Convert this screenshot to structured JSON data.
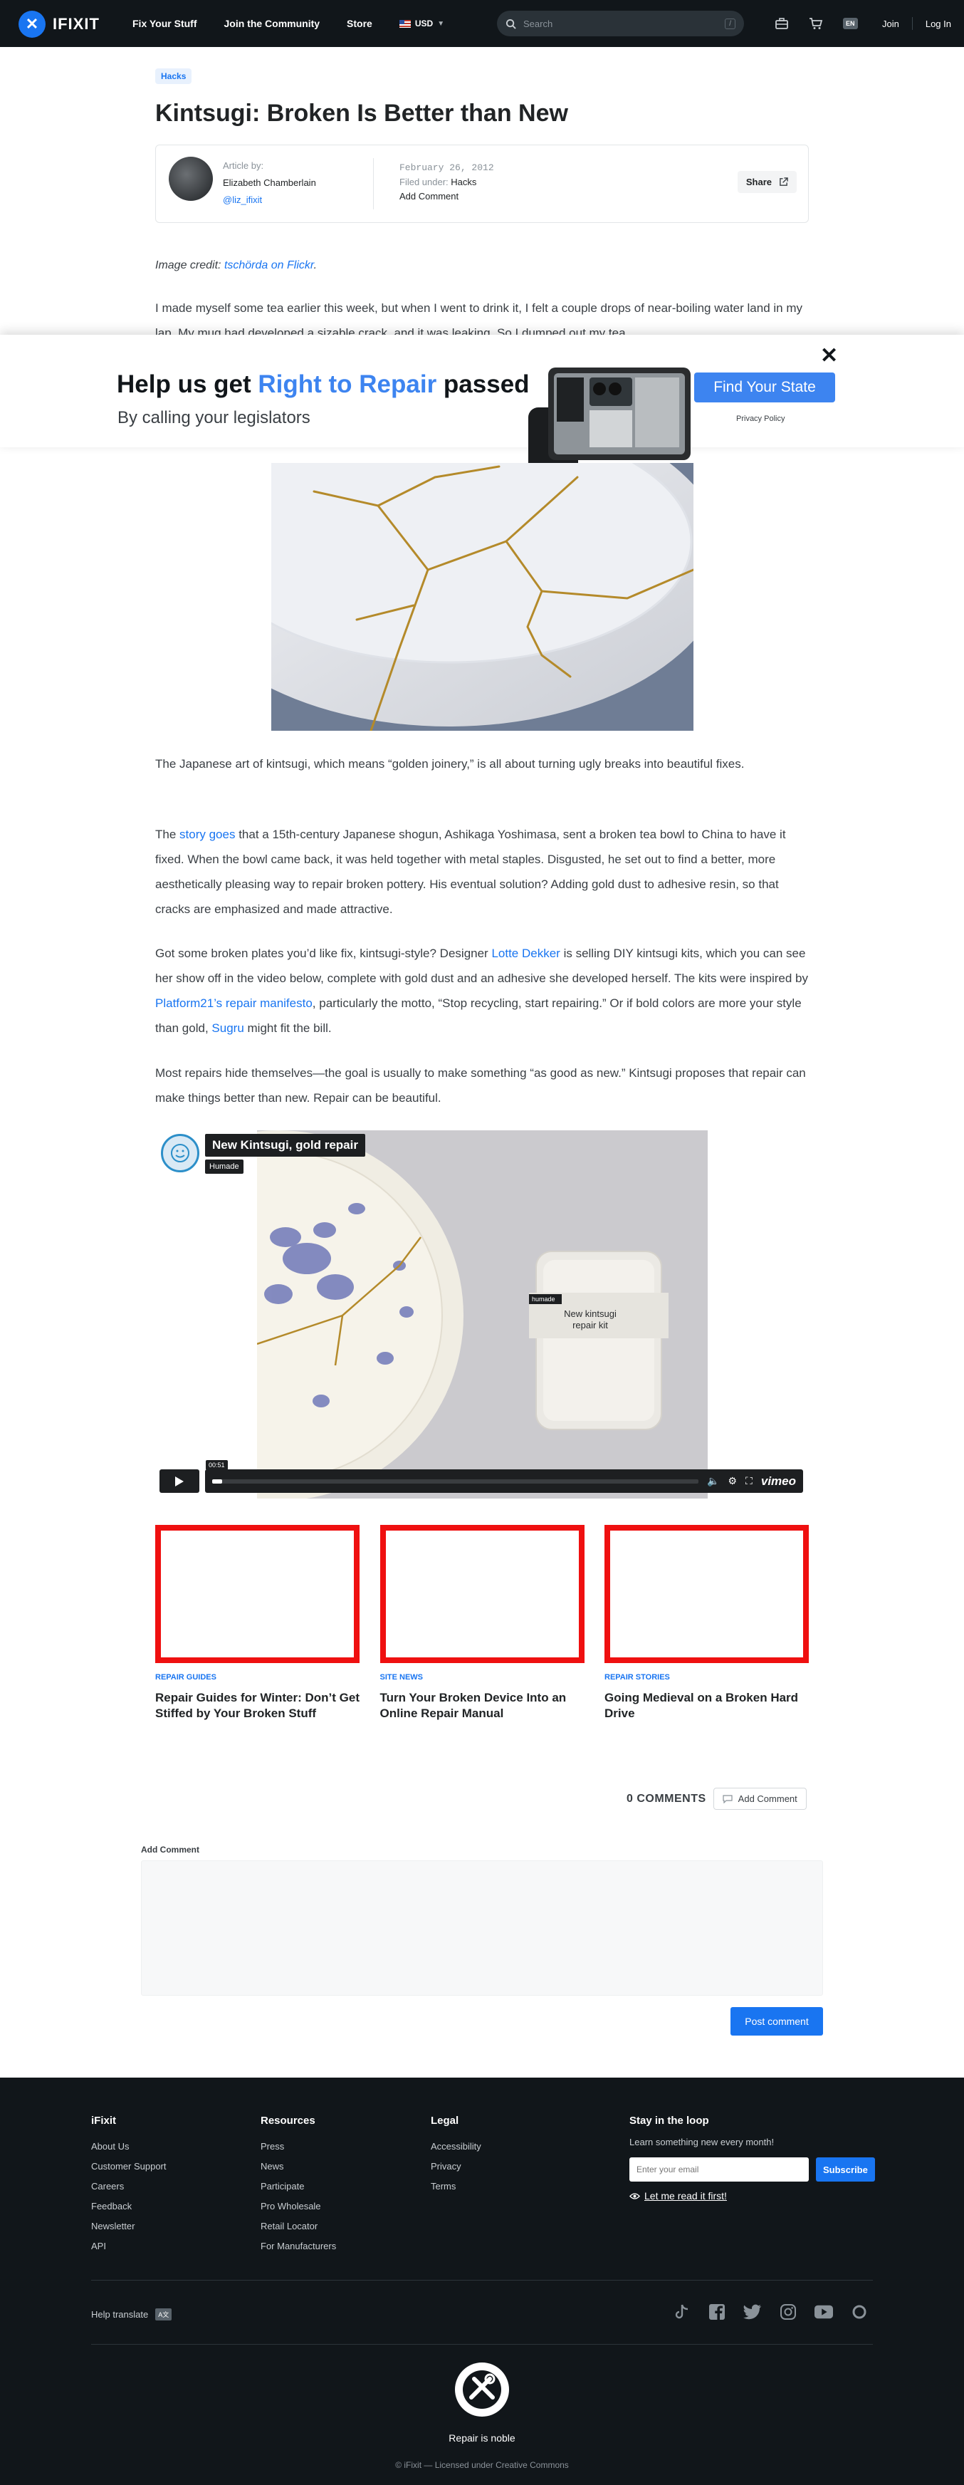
{
  "nav": {
    "logo_text": "IFIXIT",
    "links": [
      "Fix Your Stuff",
      "Join the Community",
      "Store"
    ],
    "currency": "USD",
    "search_placeholder": "Search",
    "search_key": "/",
    "lang": "EN",
    "join": "Join",
    "login": "Log In"
  },
  "article": {
    "tag": "Hacks",
    "title": "Kintsugi: Broken Is Better than New",
    "article_by": "Article by:",
    "author": "Elizabeth Chamberlain",
    "handle": "@liz_ifixit",
    "date": "February 26, 2012",
    "filed_under_label": "Filed under:",
    "filed_under": "Hacks",
    "add_comment": "Add Comment",
    "share": "Share",
    "credit_label": "Image credit:",
    "credit_link": "tschörda on Flickr",
    "intro": "I made myself some tea earlier this week, but when I went to drink it, I felt a couple drops of near-boiling water land in my lap. My mug had developed a sizable crack, and it was leaking. So I dumped out my tea"
  },
  "banner": {
    "title_pre": "Help us get ",
    "title_accent": "Right to Repair",
    "title_post": " passed",
    "subtitle": "By calling your legislators",
    "button": "Find Your State",
    "privacy": "Privacy Policy",
    "close": "✕"
  },
  "paragraphs": {
    "p1": "The Japanese art of kintsugi, which means “golden joinery,” is all about turning ugly breaks into beautiful fixes.",
    "p2_a": "The ",
    "p2_link": "story goes",
    "p2_b": " that a 15th-century Japanese shogun, Ashikaga Yoshimasa, sent a broken tea bowl to China to have it fixed. When the bowl came back, it was held together with metal staples. Disgusted, he set out to find a better, more aesthetically pleasing way to repair broken pottery. His eventual solution? Adding gold dust to adhesive resin, so that cracks are emphasized and made attractive.",
    "p3_a": "Got some broken plates you’d like fix, kintsugi-style? Designer ",
    "p3_link1": "Lotte Dekker",
    "p3_b": " is selling DIY kintsugi kits, which you can see her show off in the video below, complete with gold dust and an adhesive she developed herself. The kits were inspired by ",
    "p3_link2": "Platform21’s repair manifesto",
    "p3_c": ", particularly the motto, “Stop recycling, start repairing.”  Or if bold colors are more your style than gold, ",
    "p3_link3": "Sugru",
    "p3_d": " might fit the bill.",
    "p4": "Most repairs hide themselves—the goal is usually to make something “as good as new.” Kintsugi proposes that repair can make things better than new. Repair can be beautiful."
  },
  "video": {
    "title": "New Kintsugi, gold repair",
    "channel": "Humade",
    "timecode": "00:51",
    "kit_brand": "humade",
    "kit_label_1": "New kintsugi",
    "kit_label_2": "repair kit",
    "player_brand": "vimeo",
    "progress": 0.02
  },
  "related": [
    {
      "category": "REPAIR GUIDES",
      "title": "Repair Guides for Winter: Don’t Get Stiffed by Your Broken Stuff"
    },
    {
      "category": "SITE NEWS",
      "title": "Turn Your Broken Device Into an Online Repair Manual"
    },
    {
      "category": "REPAIR STORIES",
      "title": "Going Medieval on a Broken Hard Drive"
    }
  ],
  "comments": {
    "count_label": "0 COMMENTS",
    "add_button": "Add Comment",
    "form_label": "Add Comment",
    "post_button": "Post comment"
  },
  "footer": {
    "cols": [
      {
        "heading": "iFixit",
        "links": [
          "About Us",
          "Customer Support",
          "Careers",
          "Feedback",
          "Newsletter",
          "API"
        ]
      },
      {
        "heading": "Resources",
        "links": [
          "Press",
          "News",
          "Participate",
          "Pro Wholesale",
          "Retail Locator",
          "For Manufacturers"
        ]
      },
      {
        "heading": "Legal",
        "links": [
          "Accessibility",
          "Privacy",
          "Terms"
        ]
      }
    ],
    "newsletter_heading": "Stay in the loop",
    "newsletter_text": "Learn something new every month!",
    "email_placeholder": "Enter your email",
    "subscribe": "Subscribe",
    "read_first": "Let me read it first!",
    "help_translate": "Help translate",
    "tagline": "Repair is noble",
    "copyright": "© iFixit — Licensed under Creative Commons"
  },
  "colors": {
    "nav_bg": "#11161a",
    "brand_blue": "#1975f1",
    "banner_accent": "#3d84f0",
    "card_border": "#ef1010"
  }
}
